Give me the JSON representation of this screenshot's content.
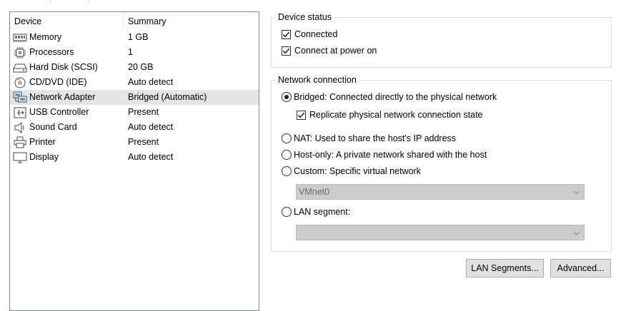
{
  "devices": {
    "headers": {
      "device": "Device",
      "summary": "Summary"
    },
    "rows": [
      {
        "name": "Memory",
        "summary": "1 GB",
        "icon": "memory-icon"
      },
      {
        "name": "Processors",
        "summary": "1",
        "icon": "processor-icon"
      },
      {
        "name": "Hard Disk (SCSI)",
        "summary": "20 GB",
        "icon": "hard-disk-icon"
      },
      {
        "name": "CD/DVD (IDE)",
        "summary": "Auto detect",
        "icon": "cd-dvd-icon"
      },
      {
        "name": "Network Adapter",
        "summary": "Bridged (Automatic)",
        "icon": "network-adapter-icon",
        "selected": true
      },
      {
        "name": "USB Controller",
        "summary": "Present",
        "icon": "usb-icon"
      },
      {
        "name": "Sound Card",
        "summary": "Auto detect",
        "icon": "sound-card-icon"
      },
      {
        "name": "Printer",
        "summary": "Present",
        "icon": "printer-icon"
      },
      {
        "name": "Display",
        "summary": "Auto detect",
        "icon": "display-icon"
      }
    ]
  },
  "device_status": {
    "title": "Device status",
    "connected": {
      "label": "Connected",
      "checked": true
    },
    "connect_at_power_on": {
      "label": "Connect at power on",
      "checked": true
    }
  },
  "network_connection": {
    "title": "Network connection",
    "bridged": {
      "label": "Bridged: Connected directly to the physical network",
      "selected": true
    },
    "replicate": {
      "label": "Replicate physical network connection state",
      "checked": true
    },
    "nat": {
      "label": "NAT: Used to share the host's IP address",
      "selected": false
    },
    "host_only": {
      "label": "Host-only: A private network shared with the host",
      "selected": false
    },
    "custom": {
      "label": "Custom: Specific virtual network",
      "selected": false
    },
    "vmnet_value": "VMnet0",
    "lan_segment": {
      "label": "LAN segment:",
      "selected": false
    },
    "lan_segment_value": ""
  },
  "buttons": {
    "lan_segments": "LAN Segments...",
    "advanced": "Advanced..."
  },
  "colors": {
    "selection": "#e5e5e5",
    "disabled_combo": "#cccccc",
    "button_face": "#e1e1e1"
  }
}
